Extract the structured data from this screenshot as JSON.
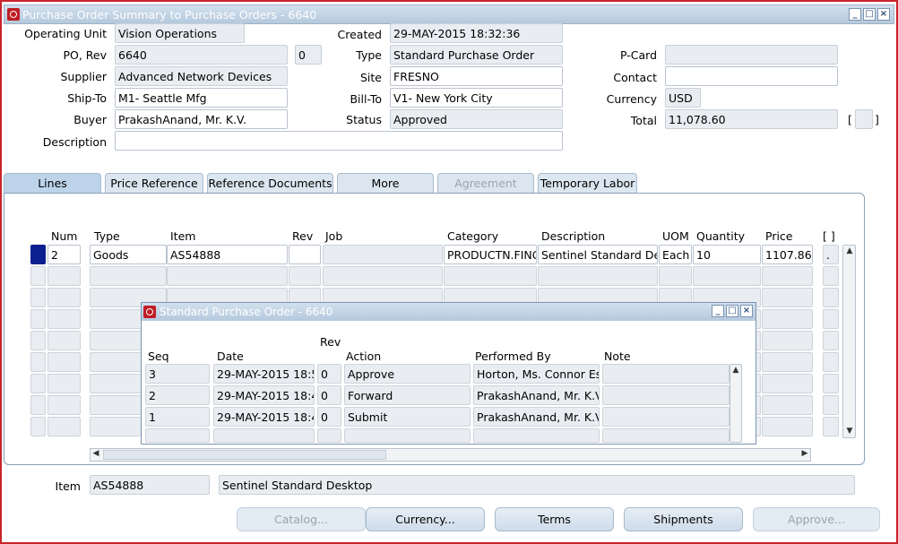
{
  "window": {
    "title": "Purchase Order Summary to Purchase Orders - 6640"
  },
  "header": {
    "operating_unit_label": "Operating Unit",
    "operating_unit": "Vision Operations",
    "po_rev_label": "PO, Rev",
    "po": "6640",
    "rev": "0",
    "supplier_label": "Supplier",
    "supplier": "Advanced Network Devices",
    "ship_to_label": "Ship-To",
    "ship_to": "M1- Seattle Mfg",
    "buyer_label": "Buyer",
    "buyer": "PrakashAnand, Mr. K.V.",
    "description_label": "Description",
    "description": "",
    "created_label": "Created",
    "created": "29-MAY-2015 18:32:36",
    "type_label": "Type",
    "type": "Standard Purchase Order",
    "site_label": "Site",
    "site": "FRESNO",
    "bill_to_label": "Bill-To",
    "bill_to": "V1- New York City",
    "status_label": "Status",
    "status": "Approved",
    "pcard_label": "P-Card",
    "pcard": "",
    "contact_label": "Contact",
    "contact": "",
    "currency_label": "Currency",
    "currency": "USD",
    "total_label": "Total",
    "total": "11,078.60",
    "dff_brackets_open": "[",
    "dff_brackets_close": "]"
  },
  "tabs": [
    {
      "label": "Lines"
    },
    {
      "label": "Price Reference"
    },
    {
      "label": "Reference Documents"
    },
    {
      "label": "More"
    },
    {
      "label": "Agreement"
    },
    {
      "label": "Temporary Labor"
    }
  ],
  "lines": {
    "columns": {
      "num": "Num",
      "type": "Type",
      "item": "Item",
      "rev": "Rev",
      "job": "Job",
      "category": "Category",
      "description": "Description",
      "uom": "UOM",
      "quantity": "Quantity",
      "price": "Price",
      "dff": "[ ]"
    },
    "rows": [
      {
        "num": "2",
        "type": "Goods",
        "item": "AS54888",
        "rev": "",
        "job": "",
        "category": "PRODUCTN.FINGOODS",
        "description": "Sentinel Standard Desktop",
        "uom": "Each",
        "quantity": "10",
        "price": "1107.86",
        "dff": "."
      }
    ]
  },
  "footer": {
    "item_label": "Item",
    "item": "AS54888",
    "item_description": "Sentinel Standard Desktop"
  },
  "buttons": {
    "catalog": "Catalog...",
    "currency": "Currency...",
    "terms": "Terms",
    "shipments": "Shipments",
    "approve": "Approve..."
  },
  "dialog": {
    "title": "Standard Purchase Order - 6640",
    "columns": {
      "seq": "Seq",
      "date": "Date",
      "rev": "Rev",
      "action": "Action",
      "performed_by": "Performed By",
      "note": "Note"
    },
    "rows": [
      {
        "seq": "3",
        "date": "29-MAY-2015 18:5",
        "rev": "0",
        "action": "Approve",
        "performed_by": "Horton, Ms. Connor Esc",
        "note": ""
      },
      {
        "seq": "2",
        "date": "29-MAY-2015 18:4",
        "rev": "0",
        "action": "Forward",
        "performed_by": "PrakashAnand, Mr. K.V",
        "note": ""
      },
      {
        "seq": "1",
        "date": "29-MAY-2015 18:4",
        "rev": "0",
        "action": "Submit",
        "performed_by": "PrakashAnand, Mr. K.V",
        "note": ""
      }
    ]
  }
}
